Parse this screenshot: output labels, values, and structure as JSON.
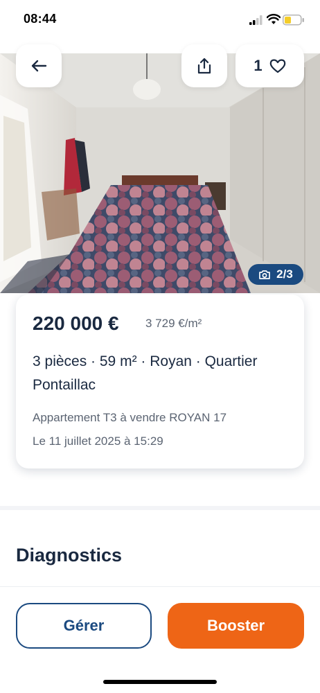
{
  "status_bar": {
    "time": "08:44"
  },
  "gallery": {
    "counter": "2/3"
  },
  "header_actions": {
    "favorites_count": "1"
  },
  "listing": {
    "price": "220 000 €",
    "price_per_m2": "3 729 €/m²",
    "features": "3 pièces · 59 m² · Royan · Quartier Pontaillac",
    "title": "Appartement T3 à vendre ROYAN 17",
    "date": "Le 11 juillet 2025 à 15:29"
  },
  "sections": {
    "diagnostics": "Diagnostics"
  },
  "actions": {
    "manage_label": "Gérer",
    "boost_label": "Booster"
  },
  "colors": {
    "primary": "#1b4a80",
    "accent": "#ee6516",
    "text": "#1a2940",
    "muted": "#5b6472"
  },
  "icons": [
    "back-arrow-icon",
    "share-icon",
    "heart-icon",
    "camera-icon",
    "signal-icon",
    "wifi-icon",
    "battery-icon"
  ]
}
